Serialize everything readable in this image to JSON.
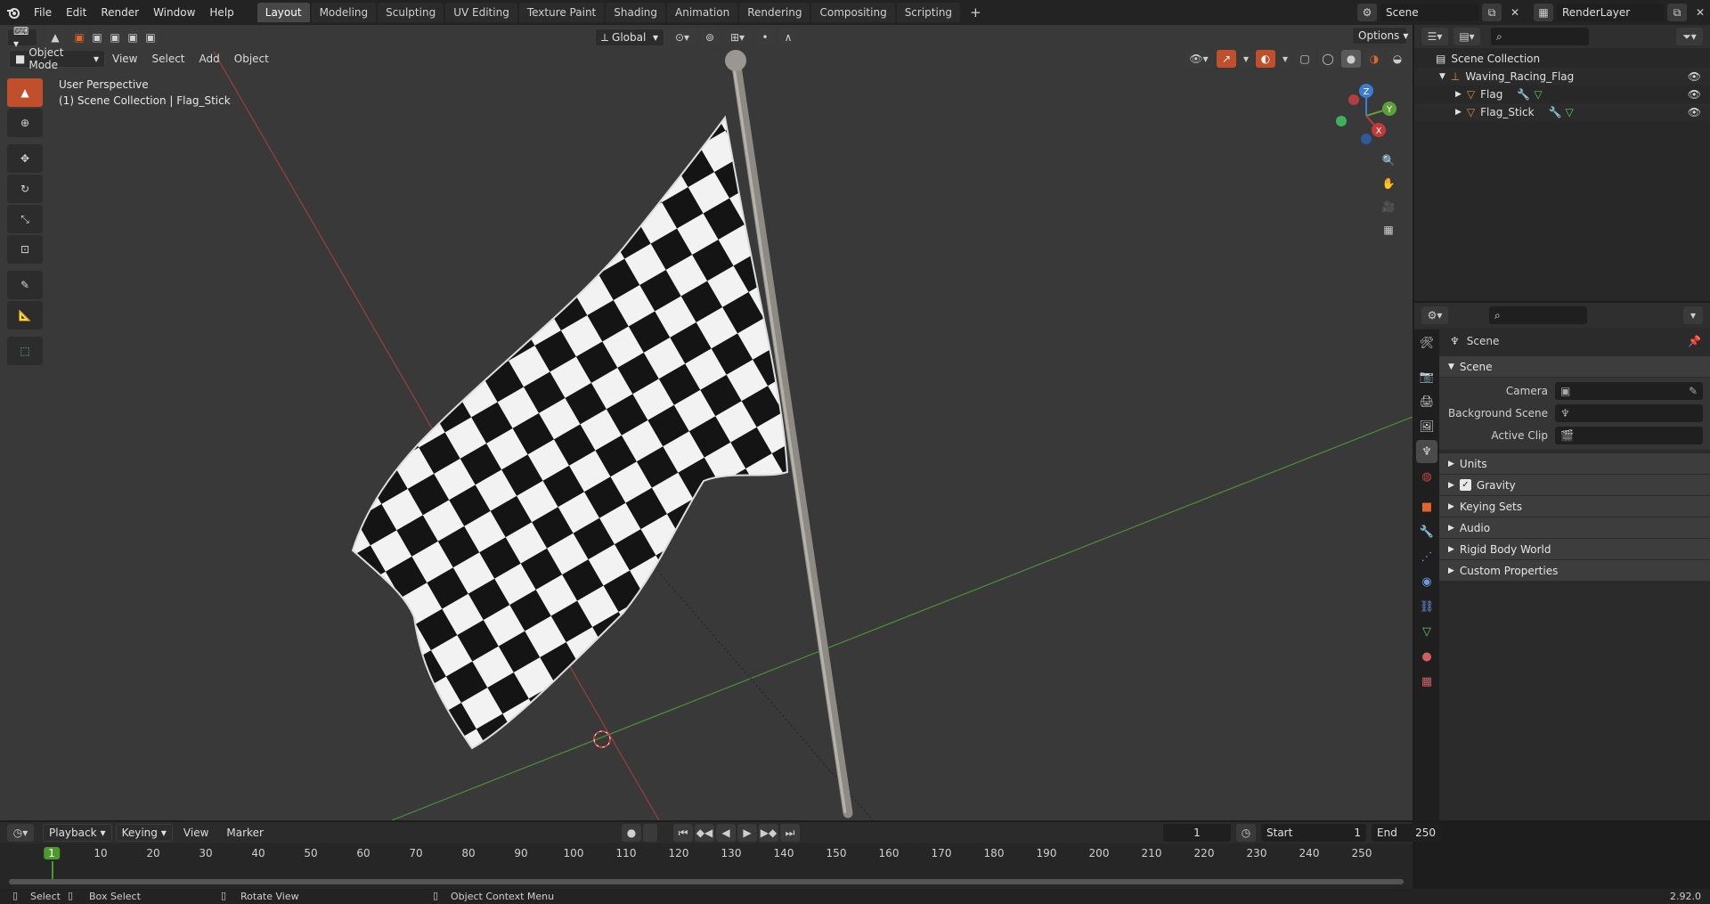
{
  "menu": {
    "items": [
      "File",
      "Edit",
      "Render",
      "Window",
      "Help"
    ]
  },
  "workspaces": {
    "tabs": [
      "Layout",
      "Modeling",
      "Sculpting",
      "UV Editing",
      "Texture Paint",
      "Shading",
      "Animation",
      "Rendering",
      "Compositing",
      "Scripting"
    ],
    "active": "Layout",
    "add_label": "+"
  },
  "scene_selector": {
    "value": "Scene"
  },
  "viewlayer_selector": {
    "value": "RenderLayer"
  },
  "viewport_header": {
    "mode": "Object Mode",
    "menus": [
      "View",
      "Select",
      "Add",
      "Object"
    ],
    "orientation": "Global",
    "options_label": "Options"
  },
  "viewport_overlay": {
    "perspective": "User Perspective",
    "collection_info": "(1) Scene Collection | Flag_Stick"
  },
  "gizmo": {
    "z": "Z",
    "y": "Y",
    "x": "X"
  },
  "outliner": {
    "root": "Scene Collection",
    "collection": "Waving_Racing_Flag",
    "objects": [
      "Flag",
      "Flag_Stick"
    ]
  },
  "properties": {
    "context": "Scene",
    "panel_title": "Scene",
    "fields": [
      {
        "label": "Camera"
      },
      {
        "label": "Background Scene"
      },
      {
        "label": "Active Clip"
      }
    ],
    "subpanels": [
      "Units",
      "Gravity",
      "Keying Sets",
      "Audio",
      "Rigid Body World",
      "Custom Properties"
    ],
    "gravity_checked": true
  },
  "timeline": {
    "menus": [
      "Playback",
      "Keying",
      "View",
      "Marker"
    ],
    "current_frame": "1",
    "start_label": "Start",
    "start": "1",
    "end_label": "End",
    "end": "250",
    "ticks": [
      "1",
      "10",
      "20",
      "30",
      "40",
      "50",
      "60",
      "70",
      "80",
      "90",
      "100",
      "110",
      "120",
      "130",
      "140",
      "150",
      "160",
      "170",
      "180",
      "190",
      "200",
      "210",
      "220",
      "230",
      "240",
      "250"
    ]
  },
  "statusbar": {
    "select": "Select",
    "box_select": "Box Select",
    "rotate_view": "Rotate View",
    "context_menu": "Object Context Menu",
    "version": "2.92.0"
  },
  "colors": {
    "accent": "#4772b3",
    "active_tool": "#e0662a",
    "x_axis": "#c43838",
    "y_axis": "#5fa03a",
    "z_axis": "#3a7cd6",
    "frame_marker": "#4b9a2c"
  }
}
